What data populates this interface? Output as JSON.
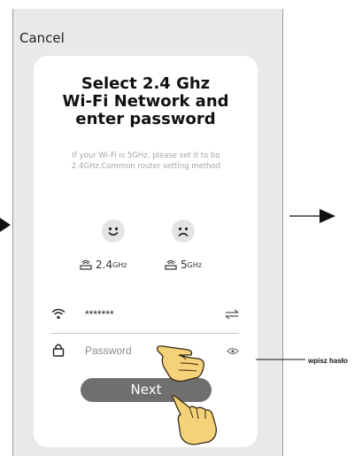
{
  "header": {
    "cancel_label": "Cancel"
  },
  "card": {
    "title_lines": [
      "Select 2.4 Ghz",
      "Wi-Fi Network and",
      "enter password"
    ],
    "hint": "If your Wi-Fi is 5GHz, please set it to bo 2.4GHz.Common router setting method"
  },
  "bands": [
    {
      "face": "happy-face-icon",
      "main": "2.4",
      "unit": "GHz"
    },
    {
      "face": "sad-face-icon",
      "main": "5",
      "unit": "GHz"
    }
  ],
  "form": {
    "wifi_value": "*******",
    "password_placeholder": "Password"
  },
  "next_label": "Next",
  "annotation": {
    "label": "wpisz hasło"
  }
}
